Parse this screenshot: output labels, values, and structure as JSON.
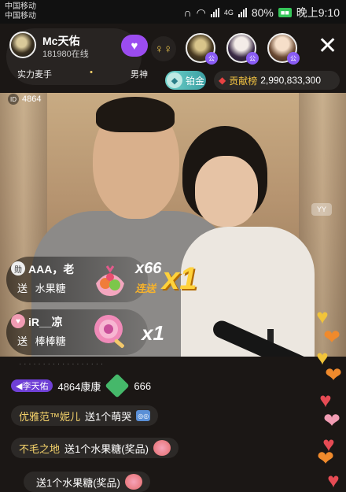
{
  "status_bar": {
    "carrier_1": "中国移动",
    "carrier_2": "中国移动",
    "network": "4G",
    "battery": "80%",
    "time": "晚上9:10"
  },
  "streamer": {
    "name": "Mc天佑",
    "online": "181980在线",
    "tag_1": "实力麦手",
    "tag_2": "男神"
  },
  "follow_icon": "follow-icon",
  "platinum": {
    "label": "铂金",
    "gem": "◆"
  },
  "contribution": {
    "label": "贡献榜",
    "value": "2,990,833,300"
  },
  "room": {
    "id": "4864",
    "watermark": "YY"
  },
  "gifts": [
    {
      "user": "AAA，老",
      "verb": "送",
      "item": "水果糖",
      "count": "x66",
      "combo_tag": "连送",
      "combo_big": "x1"
    },
    {
      "user": "iR__凉",
      "verb": "送",
      "item": "棒棒糖",
      "count": "x1"
    }
  ],
  "chat": [
    {
      "badge": "李天佑",
      "user": "4864康康",
      "text": "666"
    },
    {
      "user": "优雅范™妮儿",
      "text": "送1个萌哭"
    },
    {
      "user": "不毛之地",
      "text": "送1个水果糖(奖品)"
    },
    {
      "user": "",
      "text": "送1个水果糖(奖品)"
    }
  ],
  "icons": {
    "close": "close-icon",
    "heart": "heart-icon",
    "diamond": "diamond-icon"
  }
}
